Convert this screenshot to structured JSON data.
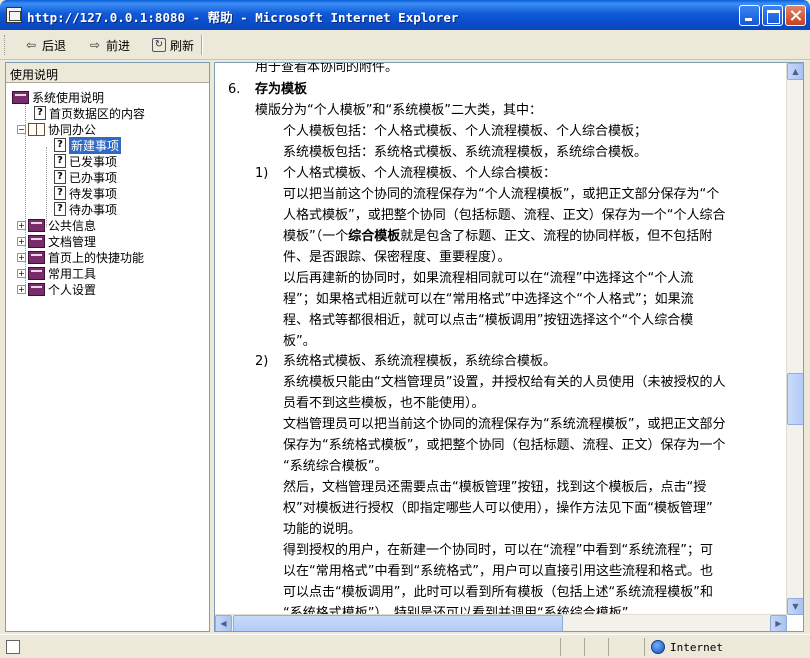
{
  "window": {
    "title": "http://127.0.0.1:8080 - 帮助 - Microsoft Internet Explorer"
  },
  "toolbar": {
    "back": "后退",
    "forward": "前进",
    "refresh": "刷新"
  },
  "sidebar": {
    "header": "使用说明",
    "tree": {
      "root": "系统使用说明",
      "item1": "首页数据区的内容",
      "item2": "协同办公",
      "sub1": "新建事项",
      "sub2": "已发事项",
      "sub3": "已办事项",
      "sub4": "待发事项",
      "sub5": "待办事项",
      "item3": "公共信息",
      "item4": "文档管理",
      "item5": "首页上的快捷功能",
      "item6": "常用工具",
      "item7": "个人设置"
    }
  },
  "content": {
    "l0": "用于查看本协同的附件。",
    "sec_num": "6.",
    "sec_title": "存为模板",
    "l1": "模版分为“个人模板”和“系统模板”二大类，其中：",
    "l2": "个人模板包括：个人格式模板、个人流程模板、个人综合模板；",
    "l3": "系统模板包括：系统格式模板、系统流程模板，系统综合模板。",
    "n1": "1)",
    "l4": "个人格式模板、个人流程模板、个人综合模板：",
    "l5": "可以把当前这个协同的流程保存为“个人流程模板”，或把正文部分保存为“个",
    "l6": "人格式模板”，或把整个协同（包括标题、流程、正文）保存为一个“个人综合",
    "l7a": "模板”（一个",
    "l7b": "综合模板",
    "l7c": "就是包含了标题、正文、流程的协同样板，但不包括附",
    "l8": "件、是否跟踪、保密程度、重要程度）。",
    "l9": "以后再建新的协同时，如果流程相同就可以在“流程”中选择这个“个人流",
    "l10": "程”；如果格式相近就可以在“常用格式”中选择这个“个人格式”；如果流",
    "l11": "程、格式等都很相近，就可以点击“模板调用”按钮选择这个“个人综合模",
    "l12": "板”。",
    "n2": "2)",
    "l13": "系统格式模板、系统流程模板，系统综合模板。",
    "l14": "系统模板只能由“文档管理员”设置，并授权给有关的人员使用（未被授权的人",
    "l15": "员看不到这些模板，也不能使用）。",
    "l16": "文档管理员可以把当前这个协同的流程保存为“系统流程模板”，或把正文部分",
    "l17": "保存为“系统格式模板”，或把整个协同（包括标题、流程、正文）保存为一个",
    "l18": "“系统综合模板”。",
    "l19": "然后，文档管理员还需要点击“模板管理”按钮，找到这个模板后，点击“授",
    "l20": "权”对模板进行授权（即指定哪些人可以使用），操作方法见下面“模板管理”",
    "l21": "功能的说明。",
    "l22": "得到授权的用户，在新建一个协同时，可以在“流程”中看到“系统流程”；可",
    "l23": "以在“常用格式”中看到“系统格式”，用户可以直接引用这些流程和格式。也",
    "l24": "可以点击“模板调用”，此时可以看到所有模板（包括上述“系统流程模板”和",
    "l25": "“系统格式模板”），特别是还可以看到并调用“系统综合模板”。"
  },
  "status": {
    "zone": "Internet"
  }
}
